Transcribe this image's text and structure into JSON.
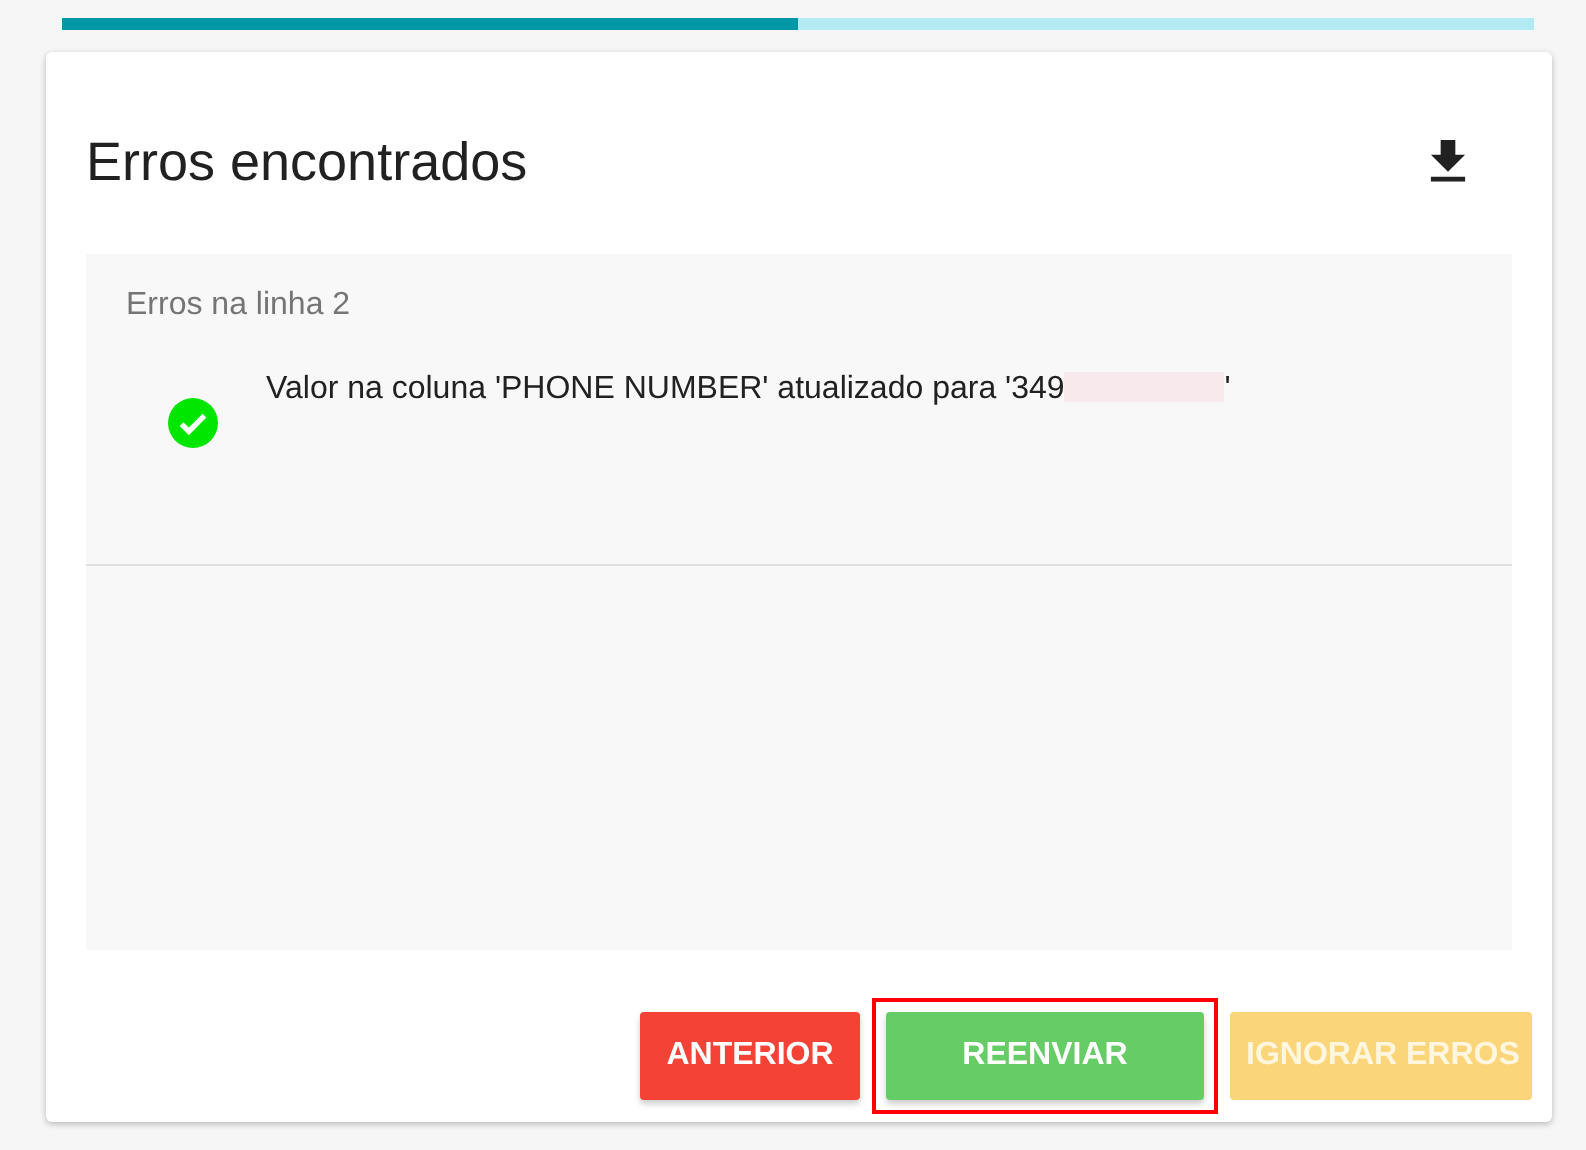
{
  "progress": {
    "level": 0.5
  },
  "card": {
    "title": "Erros encontrados",
    "errors": [
      {
        "heading": "Erros na linha 2",
        "messages": [
          {
            "resolved": true,
            "text": "Valor na coluna 'PHONE NUMBER' atualizado para '349",
            "redacted": true,
            "suffix": "'"
          }
        ]
      }
    ],
    "buttons": [
      {
        "label": "ANTERIOR",
        "kind": "danger",
        "disabled": false,
        "highlighted": false
      },
      {
        "label": "REENVIAR",
        "kind": "success",
        "disabled": false,
        "highlighted": true
      },
      {
        "label": "IGNORAR ERROS",
        "kind": "warning",
        "disabled": true,
        "highlighted": false
      }
    ]
  }
}
